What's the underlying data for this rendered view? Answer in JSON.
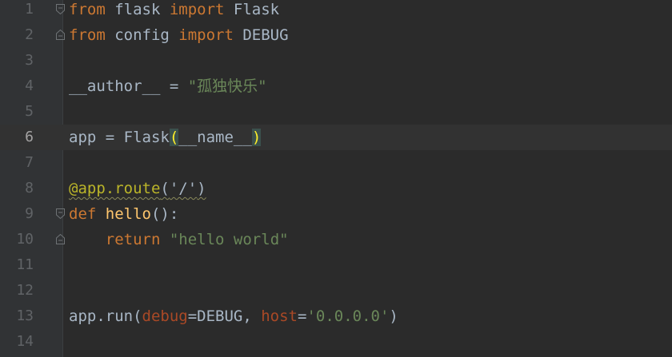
{
  "editor": {
    "current_line": 6,
    "lines": [
      {
        "n": "1",
        "tokens": [
          {
            "t": "from",
            "c": "kw"
          },
          {
            "t": " flask ",
            "c": ""
          },
          {
            "t": "import",
            "c": "kw"
          },
          {
            "t": " Flask",
            "c": ""
          }
        ],
        "fold": "start"
      },
      {
        "n": "2",
        "tokens": [
          {
            "t": "from",
            "c": "kw"
          },
          {
            "t": " config ",
            "c": ""
          },
          {
            "t": "import",
            "c": "kw"
          },
          {
            "t": " DEBUG",
            "c": ""
          }
        ],
        "fold": "end"
      },
      {
        "n": "3",
        "tokens": []
      },
      {
        "n": "4",
        "tokens": [
          {
            "t": "__author__ = ",
            "c": ""
          },
          {
            "t": "\"孤独快乐\"",
            "c": "str"
          }
        ]
      },
      {
        "n": "5",
        "tokens": []
      },
      {
        "n": "6",
        "tokens": [
          {
            "t": "app = Flask",
            "c": ""
          },
          {
            "t": "(",
            "c": "bracket-hl"
          },
          {
            "t": "__name__",
            "c": ""
          },
          {
            "t": ")",
            "c": "bracket-hl"
          }
        ]
      },
      {
        "n": "7",
        "tokens": []
      },
      {
        "n": "8",
        "tokens": [
          {
            "t": "@app.route",
            "c": "deco"
          },
          {
            "t": "(",
            "c": "deco-paren"
          },
          {
            "t": "'/'",
            "c": "str deco-paren"
          },
          {
            "t": ")",
            "c": "deco-paren"
          }
        ]
      },
      {
        "n": "9",
        "tokens": [
          {
            "t": "def",
            "c": "kw"
          },
          {
            "t": " ",
            "c": ""
          },
          {
            "t": "hello",
            "c": "fn"
          },
          {
            "t": "():",
            "c": ""
          }
        ],
        "fold": "start"
      },
      {
        "n": "10",
        "tokens": [
          {
            "t": "    ",
            "c": ""
          },
          {
            "t": "return",
            "c": "kw"
          },
          {
            "t": " ",
            "c": ""
          },
          {
            "t": "\"hello world\"",
            "c": "str"
          }
        ],
        "fold": "end"
      },
      {
        "n": "11",
        "tokens": []
      },
      {
        "n": "12",
        "tokens": []
      },
      {
        "n": "13",
        "tokens": [
          {
            "t": "app.run(",
            "c": ""
          },
          {
            "t": "debug",
            "c": "param"
          },
          {
            "t": "=DEBUG, ",
            "c": ""
          },
          {
            "t": "host",
            "c": "param"
          },
          {
            "t": "=",
            "c": ""
          },
          {
            "t": "'0.0.0.0'",
            "c": "str"
          },
          {
            "t": ")",
            "c": ""
          }
        ]
      },
      {
        "n": "14",
        "tokens": []
      }
    ]
  },
  "colors": {
    "background": "#2b2b2b",
    "gutter": "#313335",
    "keyword": "#cc7832",
    "string": "#6a8759",
    "decorator": "#bbb529",
    "function": "#ffc66d",
    "parameter": "#aa4926",
    "text": "#a9b7c6",
    "line_number": "#606366"
  }
}
